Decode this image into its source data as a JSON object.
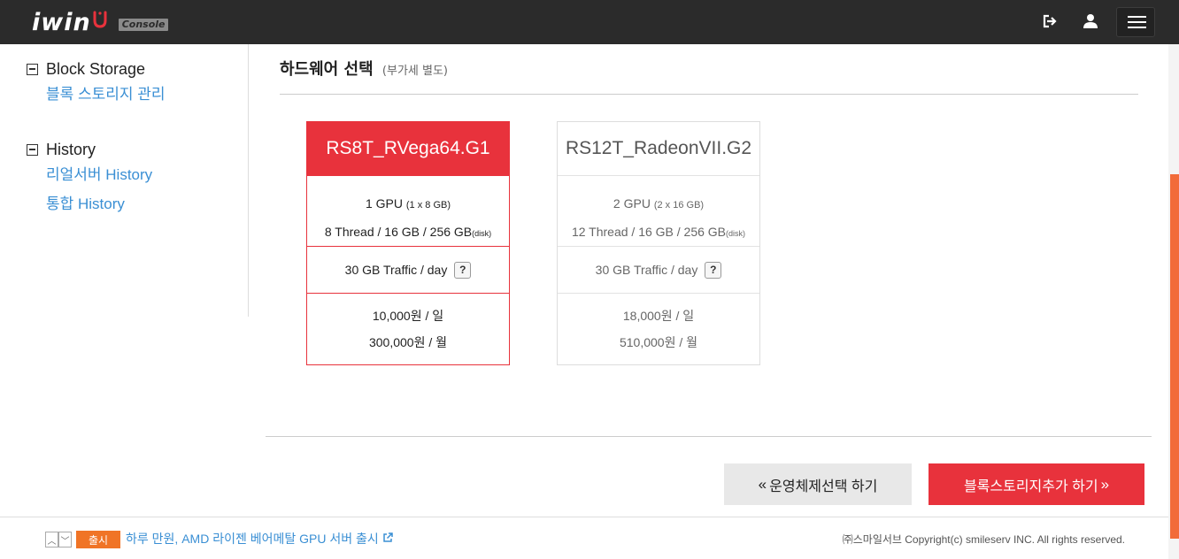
{
  "header": {
    "logo_text": "iwin",
    "console_label": "Console",
    "icons": [
      "logout-icon",
      "user-icon",
      "hamburger-menu-icon"
    ]
  },
  "sidebar": {
    "groups": [
      {
        "title": "Block Storage",
        "items": [
          {
            "label": "블록 스토리지 관리"
          }
        ]
      },
      {
        "title": "History",
        "items": [
          {
            "label": "리얼서버 History"
          },
          {
            "label": "통합 History"
          }
        ]
      }
    ]
  },
  "main": {
    "section_title": "하드웨어 선택",
    "section_subtitle": "(부가세 별도)",
    "cards": [
      {
        "name": "RS8T_RVega64.G1",
        "selected": true,
        "gpu_line": "1 GPU ",
        "gpu_detail": "(1 x 8 GB)",
        "spec_line": "8 Thread / 16 GB / 256 GB",
        "spec_detail": "(disk)",
        "traffic": "30 GB Traffic / day",
        "help": "?",
        "price_day": "10,000원 / 일",
        "price_month": "300,000원 / 월"
      },
      {
        "name": "RS12T_RadeonVII.G2",
        "selected": false,
        "gpu_line": "2 GPU ",
        "gpu_detail": "(2 x 16 GB)",
        "spec_line": "12 Thread / 16 GB / 256 GB",
        "spec_detail": "(disk)",
        "traffic": "30 GB Traffic / day",
        "help": "?",
        "price_day": "18,000원 / 일",
        "price_month": "510,000원 / 월"
      }
    ],
    "back_button": "운영체제선택 하기",
    "next_button": "블록스토리지추가 하기"
  },
  "footer": {
    "badge": "출시",
    "news": "하루 만원, AMD 라이젠 베어메탈 GPU 서버 출시",
    "copyright": "㈜스마일서브 Copyright(c) smileserv INC. All rights reserved."
  },
  "colors": {
    "accent": "#e8323c",
    "link": "#3a8fd4",
    "badge": "#f07426",
    "topbar": "#2b2b2b"
  }
}
